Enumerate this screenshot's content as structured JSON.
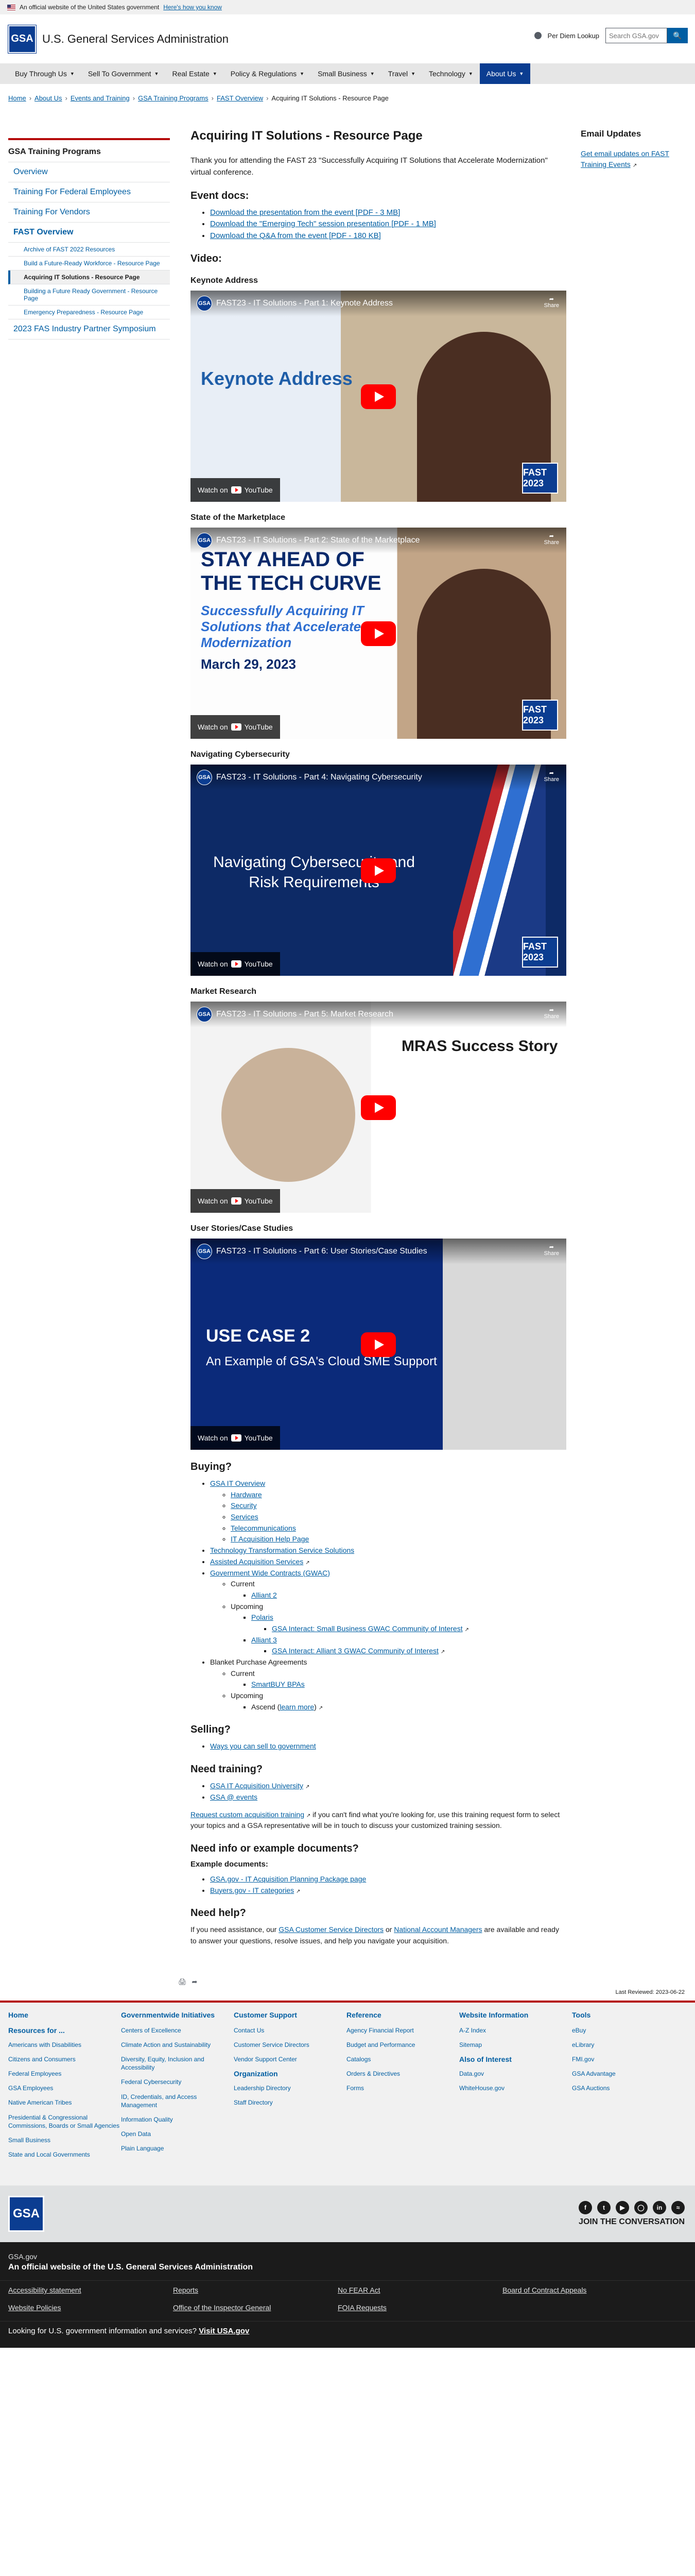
{
  "banner": {
    "text": "An official website of the United States government",
    "link": "Here's how you know"
  },
  "header": {
    "logo": "GSA",
    "agency": "U.S. General Services Administration",
    "staff_lookup": "Per Diem Lookup",
    "search_placeholder": "Search GSA.gov"
  },
  "nav": [
    {
      "label": "Buy Through Us"
    },
    {
      "label": "Sell To Government"
    },
    {
      "label": "Real Estate"
    },
    {
      "label": "Policy & Regulations"
    },
    {
      "label": "Small Business"
    },
    {
      "label": "Travel"
    },
    {
      "label": "Technology"
    },
    {
      "label": "About Us"
    }
  ],
  "breadcrumbs": [
    "Home",
    "About Us",
    "Events and Training",
    "GSA Training Programs",
    "FAST Overview",
    "Acquiring IT Solutions - Resource Page"
  ],
  "sidenav": {
    "title": "GSA Training Programs",
    "items": [
      "Overview",
      "Training For Federal Employees",
      "Training For Vendors",
      "FAST Overview"
    ],
    "subitems": [
      "Archive of FAST 2022 Resources",
      "Build a Future-Ready Workforce - Resource Page",
      "Acquiring IT Solutions - Resource Page",
      "Building a Future Ready Government - Resource Page",
      "Emergency Preparedness - Resource Page"
    ],
    "last": "2023 FAS Industry Partner Symposium"
  },
  "main": {
    "title": "Acquiring IT Solutions - Resource Page",
    "intro": "Thank you for attending the FAST 23 \"Successfully Acquiring IT Solutions that Accelerate Modernization\" virtual conference.",
    "event_docs_heading": "Event docs:",
    "docs": [
      "Download the presentation from the event [PDF - 3 MB]",
      "Download the \"Emerging Tech\" session presentation [PDF - 1 MB]",
      "Download the Q&A from the event [PDF - 180 KB]"
    ],
    "video_heading": "Video:",
    "videos": [
      {
        "heading": "Keynote Address",
        "title": "FAST23 - IT Solutions - Part 1: Keynote Address",
        "overlay": "Keynote Address"
      },
      {
        "heading": "State of the Marketplace",
        "title": "FAST23 - IT Solutions - Part 2: State of the Marketplace",
        "overlay1": "STAY AHEAD OF",
        "overlay2": "THE TECH CURVE",
        "overlay3": "Successfully Acquiring IT Solutions that Accelerate Modernization",
        "overlay4": "March 29, 2023"
      },
      {
        "heading": "Navigating Cybersecurity",
        "title": "FAST23 - IT Solutions - Part 4: Navigating Cybersecurity",
        "overlay": "Navigating Cybersecurity and Risk Requirements"
      },
      {
        "heading": "Market Research",
        "title": "FAST23 - IT Solutions - Part 5: Market Research",
        "overlay": "MRAS Success Story"
      },
      {
        "heading": "User Stories/Case Studies",
        "title": "FAST23 - IT Solutions - Part 6: User Stories/Case Studies",
        "overlay1": "USE CASE 2",
        "overlay2": "An Example of GSA's Cloud SME Support"
      }
    ],
    "watch_on": "Watch on",
    "youtube": "YouTube",
    "share": "Share",
    "fast_badge": "FAST 2023",
    "buying_heading": "Buying?",
    "buying": {
      "it_overview": "GSA IT Overview",
      "it_sub": [
        "Hardware",
        "Security",
        "Services",
        "Telecommunications",
        "IT Acquisition Help Page"
      ],
      "tts": "Technology Transformation Service Solutions",
      "aas": "Assisted Acquisition Services",
      "gwac": "Government Wide Contracts (GWAC)",
      "current": "Current",
      "alliant2": "Alliant 2",
      "upcoming": "Upcoming",
      "polaris": "Polaris",
      "polaris_sub": "GSA Interact: Small Business GWAC Community of Interest",
      "alliant3": "Alliant 3",
      "alliant3_sub": "GSA Interact: Alliant 3 GWAC Community of Interest",
      "bpa": "Blanket Purchase Agreements",
      "current2": "Current",
      "smartbuy": "SmartBUY BPAs",
      "upcoming2": "Upcoming",
      "ascend": "Ascend (",
      "learn_more": "learn more",
      "ascend_end": ")"
    },
    "selling_heading": "Selling?",
    "selling_link": "Ways you can sell to government",
    "training_heading": "Need training?",
    "training_links": [
      "GSA IT Acquisition University",
      "GSA @ events"
    ],
    "training_text_link": "Request custom acquisition training",
    "training_text": " if you can't find what you're looking for, use this training request form to select your topics and a GSA representative will be in touch to discuss your customized training session.",
    "info_heading": "Need info or example documents?",
    "example_heading": "Example documents:",
    "example_links": [
      "GSA.gov - IT Acquisition Planning Package page",
      "Buyers.gov - IT categories"
    ],
    "help_heading": "Need help?",
    "help_text1": "If you need assistance, our ",
    "help_link1": "GSA Customer Service Directors",
    "help_text2": " or ",
    "help_link2": "National Account Managers",
    "help_text3": " are available and ready to answer your questions, resolve issues, and help you navigate your acquisition."
  },
  "rightcol": {
    "title": "Email Updates",
    "link": "Get email updates on FAST Training Events"
  },
  "last_reviewed": "Last Reviewed: 2023-06-22",
  "footer": {
    "home": "Home",
    "resources": {
      "title": "Resources for ...",
      "items": [
        "Americans with Disabilities",
        "Citizens and Consumers",
        "Federal Employees",
        "GSA Employees",
        "Native American Tribes",
        "Presidential & Congressional Commissions, Boards or Small Agencies",
        "Small Business",
        "State and Local Governments"
      ]
    },
    "initiatives": {
      "title": "Governmentwide Initiatives",
      "items": [
        "Centers of Excellence",
        "Climate Action and Sustainability",
        "Diversity, Equity, Inclusion and Accessibility",
        "Federal Cybersecurity",
        "ID, Credentials, and Access Management",
        "Information Quality",
        "Open Data",
        "Plain Language"
      ]
    },
    "support": {
      "title": "Customer Support",
      "items": [
        "Contact Us",
        "Customer Service Directors",
        "Vendor Support Center"
      ],
      "org_title": "Organization",
      "org_items": [
        "Leadership Directory",
        "Staff Directory"
      ]
    },
    "reference": {
      "title": "Reference",
      "items": [
        "Agency Financial Report",
        "Budget and Performance",
        "Catalogs",
        "Orders & Directives",
        "Forms"
      ]
    },
    "info": {
      "title": "Website Information",
      "items": [
        "A-Z Index",
        "Sitemap"
      ],
      "also_title": "Also of Interest",
      "also_items": [
        "Data.gov",
        "WhiteHouse.gov"
      ]
    },
    "tools": {
      "title": "Tools",
      "items": [
        "eBuy",
        "eLibrary",
        "FMI.gov",
        "GSA Advantage",
        "GSA Auctions"
      ]
    },
    "join": "JOIN THE CONVERSATION",
    "logo": "GSA"
  },
  "identifier": {
    "domain": "GSA.gov",
    "desc": "An official website of the U.S. General Services Administration",
    "links": [
      "Accessibility statement",
      "Reports",
      "No FEAR Act",
      "Board of Contract Appeals",
      "Website Policies",
      "Office of the Inspector General",
      "FOIA Requests"
    ],
    "lookup_text": "Looking for U.S. government information and services? ",
    "lookup_link": "Visit USA.gov"
  }
}
